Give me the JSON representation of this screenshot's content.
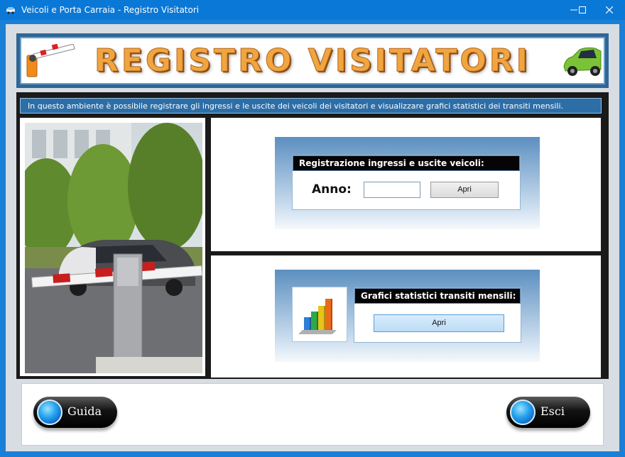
{
  "window": {
    "title": "Veicoli e Porta Carraia - Registro Visitatori",
    "icon": "app-car-icon"
  },
  "header": {
    "title": "REGISTRO VISITATORI",
    "left_icon": "barrier-icon",
    "right_icon": "car-icon"
  },
  "info_text": "In questo ambiente è possibile registrare gli ingressi e le uscite dei veicoli dei visitatori e visualizzare grafici statistici dei transiti mensili.",
  "registration": {
    "title": "Registrazione ingressi e uscite veicoli:",
    "year_label": "Anno:",
    "year_value": "",
    "open_label": "Apri"
  },
  "statistics": {
    "title": "Grafici statistici transiti mensili:",
    "icon": "bar-chart-icon",
    "open_label": "Apri"
  },
  "footer": {
    "guide_label": "Guida",
    "exit_label": "Esci"
  },
  "colors": {
    "titlebar": "#0a78d7",
    "frame_blue": "#2f6696",
    "title_orange": "#f0a640",
    "button_blue": "#bcdcf6"
  }
}
